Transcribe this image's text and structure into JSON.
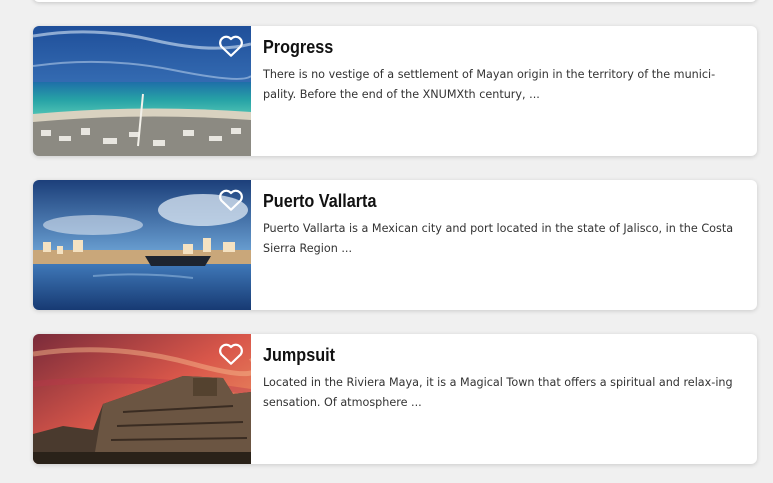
{
  "destinations": [
    {
      "title": "Progress",
      "description": "There is no vestige of a settlement of Mayan origin in the territory of the munici-pality. Before the end of the XNUMXth century, ...",
      "favorite_icon": "heart-outline-icon"
    },
    {
      "title": "Puerto Vallarta",
      "description": "Puerto Vallarta is a Mexican city and port located in the state of Jalisco, in the Costa Sierra Region ...",
      "favorite_icon": "heart-outline-icon"
    },
    {
      "title": "Jumpsuit",
      "description": "Located in the Riviera Maya, it is a Magical Town that offers a spiritual and relax-ing sensation. Of atmosphere ...",
      "favorite_icon": "heart-outline-icon"
    }
  ],
  "colors": {
    "card_background": "#ffffff",
    "page_background": "#f0f0f0",
    "heart_outline": "#ffffff"
  }
}
